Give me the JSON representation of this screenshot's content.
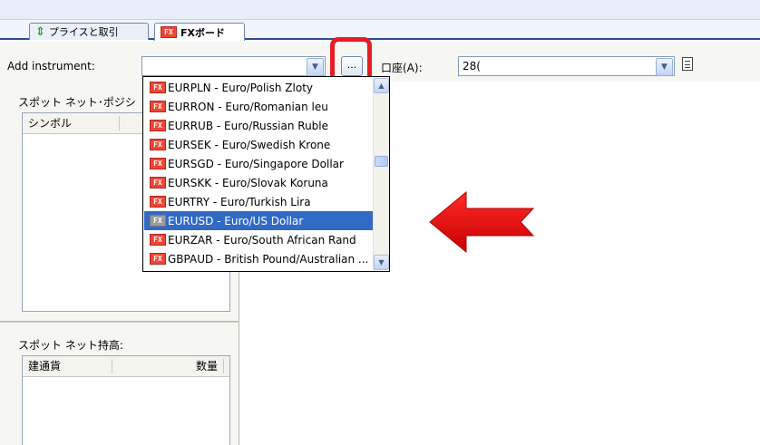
{
  "tabs": [
    {
      "label": "プライスと取引",
      "icon": "price-arrows-icon"
    },
    {
      "label": "FXボード",
      "icon": "fx-icon"
    }
  ],
  "toolbar": {
    "add_instrument_label": "Add instrument:",
    "add_instrument_value": "",
    "browse_label": "...",
    "account_label": "口座(A):",
    "account_value": "28("
  },
  "left_panel": {
    "spot_position_title": "スポット ネット･ポジシ",
    "spot_position_columns": [
      "シンボル"
    ],
    "spot_holding_title": "スポット ネット持高:",
    "spot_holding_columns": [
      "建通貨",
      "数量"
    ]
  },
  "dropdown": {
    "items": [
      {
        "code": "EURPLN - Euro/Polish Zloty",
        "selected": false
      },
      {
        "code": "EURRON - Euro/Romanian leu",
        "selected": false
      },
      {
        "code": "EURRUB - Euro/Russian Ruble",
        "selected": false
      },
      {
        "code": "EURSEK - Euro/Swedish Krone",
        "selected": false
      },
      {
        "code": "EURSGD - Euro/Singapore Dollar",
        "selected": false
      },
      {
        "code": "EURSKK - Euro/Slovak Koruna",
        "selected": false
      },
      {
        "code": "EURTRY - Euro/Turkish Lira",
        "selected": false
      },
      {
        "code": "EURUSD - Euro/US Dollar",
        "selected": true
      },
      {
        "code": "EURZAR - Euro/South African Rand",
        "selected": false
      },
      {
        "code": "GBPAUD - British Pound/Australian ...",
        "selected": false
      }
    ],
    "icon_text": "FX"
  },
  "colors": {
    "highlight": "#e61b23",
    "selection": "#316ac5",
    "fx_icon": "#ef4535"
  }
}
